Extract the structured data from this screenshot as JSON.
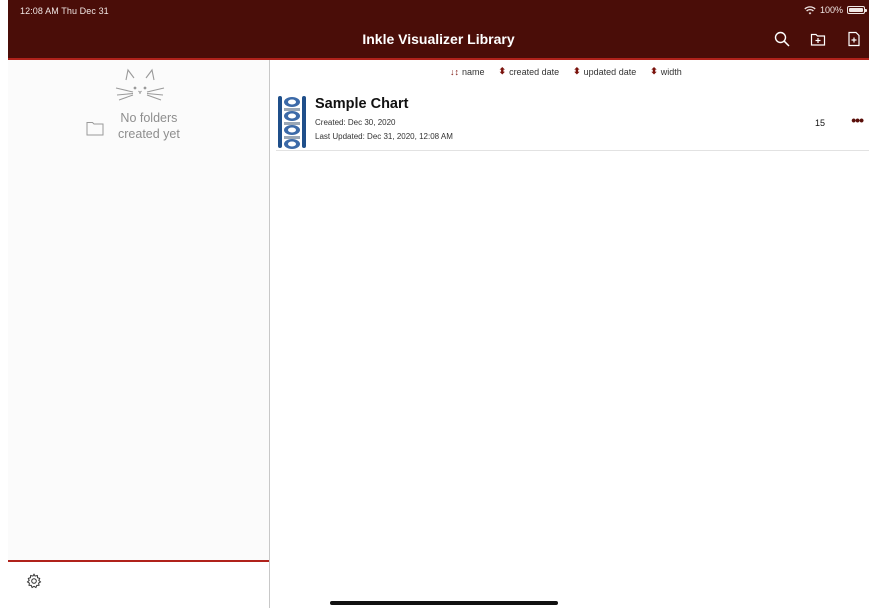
{
  "status": {
    "time": "12:08 AM  Thu Dec 31",
    "battery": "100%"
  },
  "header": {
    "title": "Inkle Visualizer Library"
  },
  "icons": {
    "search": "search-icon",
    "new_folder": "new-folder-icon",
    "new_file": "new-file-icon",
    "settings": "gear-icon",
    "folder": "folder-icon"
  },
  "sidebar": {
    "empty_line1": "No folders",
    "empty_line2": "created yet"
  },
  "sort": {
    "name": "name",
    "created": "created date",
    "updated": "updated date",
    "width": "width"
  },
  "charts": [
    {
      "title": "Sample Chart",
      "created": "Created: Dec 30, 2020",
      "updated": "Last Updated: Dec 31, 2020, 12:08 AM",
      "width": "15",
      "more": "•••"
    }
  ],
  "colors": {
    "header_bg": "#4a0d08",
    "accent": "#b0221b"
  }
}
